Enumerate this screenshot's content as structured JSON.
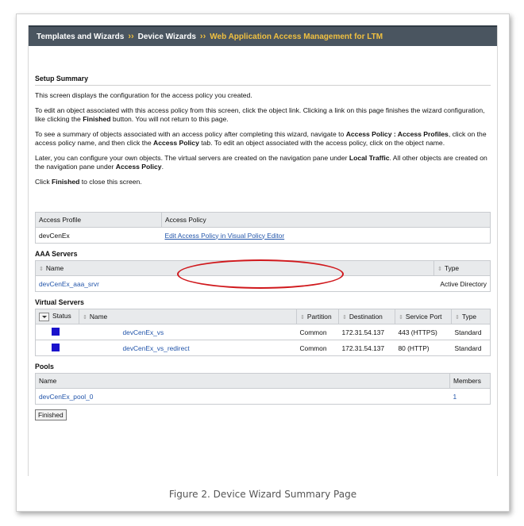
{
  "breadcrumb": {
    "item1": "Templates and Wizards",
    "item2": "Device Wizards",
    "current": "Web Application Access Management for LTM",
    "separator": "››"
  },
  "setup": {
    "title": "Setup Summary",
    "p1": "This screen displays the configuration for the access policy you created.",
    "p2a": "To edit an object associated with this access policy from this screen, click the object link. Clicking a link on this page finishes the wizard configuration, like clicking the ",
    "p2b": "Finished",
    "p2c": " button. You will not return to this page.",
    "p3a": "To see a summary of objects associated with an access policy after completing this wizard, navigate to ",
    "p3b": "Access Policy : Access Profiles",
    "p3c": ", click on the access policy name, and then click the ",
    "p3d": "Access Policy",
    "p3e": " tab. To edit an object associated with the access policy, click on the object name.",
    "p4a": "Later, you can configure your own objects. The virtual servers are created on the navigation pane under ",
    "p4b": "Local Traffic",
    "p4c": ". All other objects are created on the navigation pane under ",
    "p4d": "Access Policy",
    "p4e": ".",
    "p5a": "Click ",
    "p5b": "Finished",
    "p5c": " to close this screen."
  },
  "access_table": {
    "col1": "Access Profile",
    "col2": "Access Policy",
    "profile": "devCenEx",
    "policy_link": "Edit Access Policy in Visual Policy Editor"
  },
  "aaa": {
    "title": "AAA Servers",
    "col_name": "Name",
    "col_type": "Type",
    "rows": [
      {
        "name": "devCenEx_aaa_srvr",
        "type": "Active Directory"
      }
    ]
  },
  "vs": {
    "title": "Virtual Servers",
    "cols": {
      "status": "Status",
      "name": "Name",
      "partition": "Partition",
      "destination": "Destination",
      "port": "Service Port",
      "type": "Type"
    },
    "rows": [
      {
        "name": "devCenEx_vs",
        "partition": "Common",
        "destination": "172.31.54.137",
        "port": "443 (HTTPS)",
        "type": "Standard"
      },
      {
        "name": "devCenEx_vs_redirect",
        "partition": "Common",
        "destination": "172.31.54.137",
        "port": "80 (HTTP)",
        "type": "Standard"
      }
    ],
    "status_color": "#1a12cc"
  },
  "pools": {
    "title": "Pools",
    "col_name": "Name",
    "col_members": "Members",
    "rows": [
      {
        "name": "devCenEx_pool_0",
        "members": "1"
      }
    ]
  },
  "finished_button": "Finished",
  "caption": "Figure 2. Device Wizard Summary Page",
  "colors": {
    "link": "#2255aa",
    "highlight_oval": "#d0181c",
    "breadcrumb_current": "#f0c040"
  }
}
